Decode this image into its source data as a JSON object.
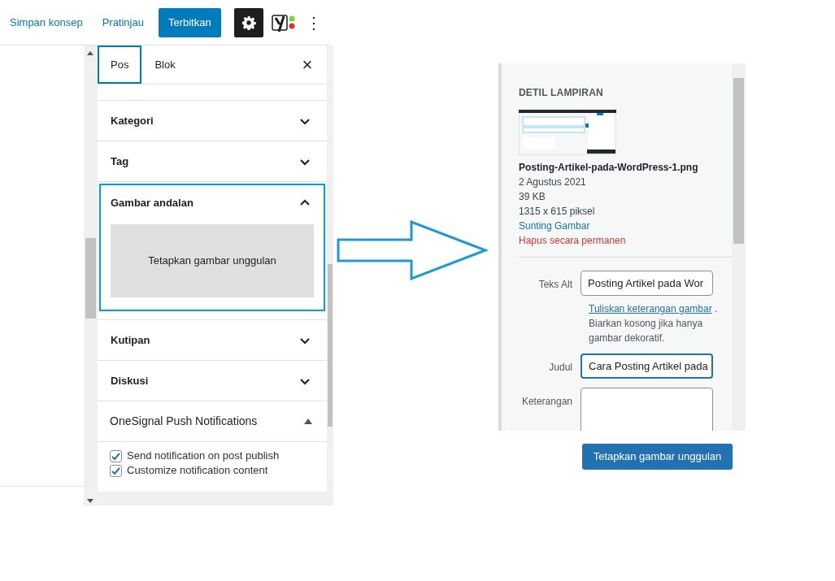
{
  "toolbar": {
    "save_draft": "Simpan konsep",
    "preview": "Pratinjau",
    "publish": "Terbitkan",
    "settings_active": true,
    "more": "⋮"
  },
  "sidebar": {
    "tabs": [
      {
        "label": "Pos",
        "selected": true
      },
      {
        "label": "Blok",
        "selected": false
      }
    ],
    "close": "×",
    "panels": [
      {
        "title": "Kategori",
        "expanded": false,
        "highlighted": false
      },
      {
        "title": "Tag",
        "expanded": false,
        "highlighted": false
      },
      {
        "title": "Gambar andalan",
        "expanded": true,
        "highlighted": true,
        "button": "Tetapkan gambar unggulan"
      },
      {
        "title": "Kutipan",
        "expanded": false,
        "highlighted": false
      },
      {
        "title": "Diskusi",
        "expanded": false,
        "highlighted": false
      }
    ],
    "onesignal": {
      "title": "OneSignal Push Notifications",
      "expanded": true,
      "options": [
        {
          "label": "Send notification on post publish",
          "checked": true
        },
        {
          "label": "Customize notification content",
          "checked": true
        }
      ]
    }
  },
  "attachment": {
    "heading": "DETIL LAMPIRAN",
    "filename": "Posting-Artikel-pada-WordPress-1.png",
    "date": "2 Agustus 2021",
    "size": "39 KB",
    "dimensions": "1315 x 615 piksel",
    "edit_link": "Sunting Gambar",
    "delete_link": "Hapus secara permanen",
    "fields": [
      {
        "label": "Teks Alt",
        "value": "Posting Artikel pada Wor",
        "focused": false
      },
      {
        "label": "Judul",
        "value": "Cara Posting Artikel pada",
        "focused": true
      }
    ],
    "alt_help_link": "Tuliskan keterangan gambar",
    "alt_help_text": ". Biarkan kosong jika hanya gambar dekoratif.",
    "caption_label": "Keterangan"
  },
  "set_featured_button": "Tetapkan gambar unggulan"
}
